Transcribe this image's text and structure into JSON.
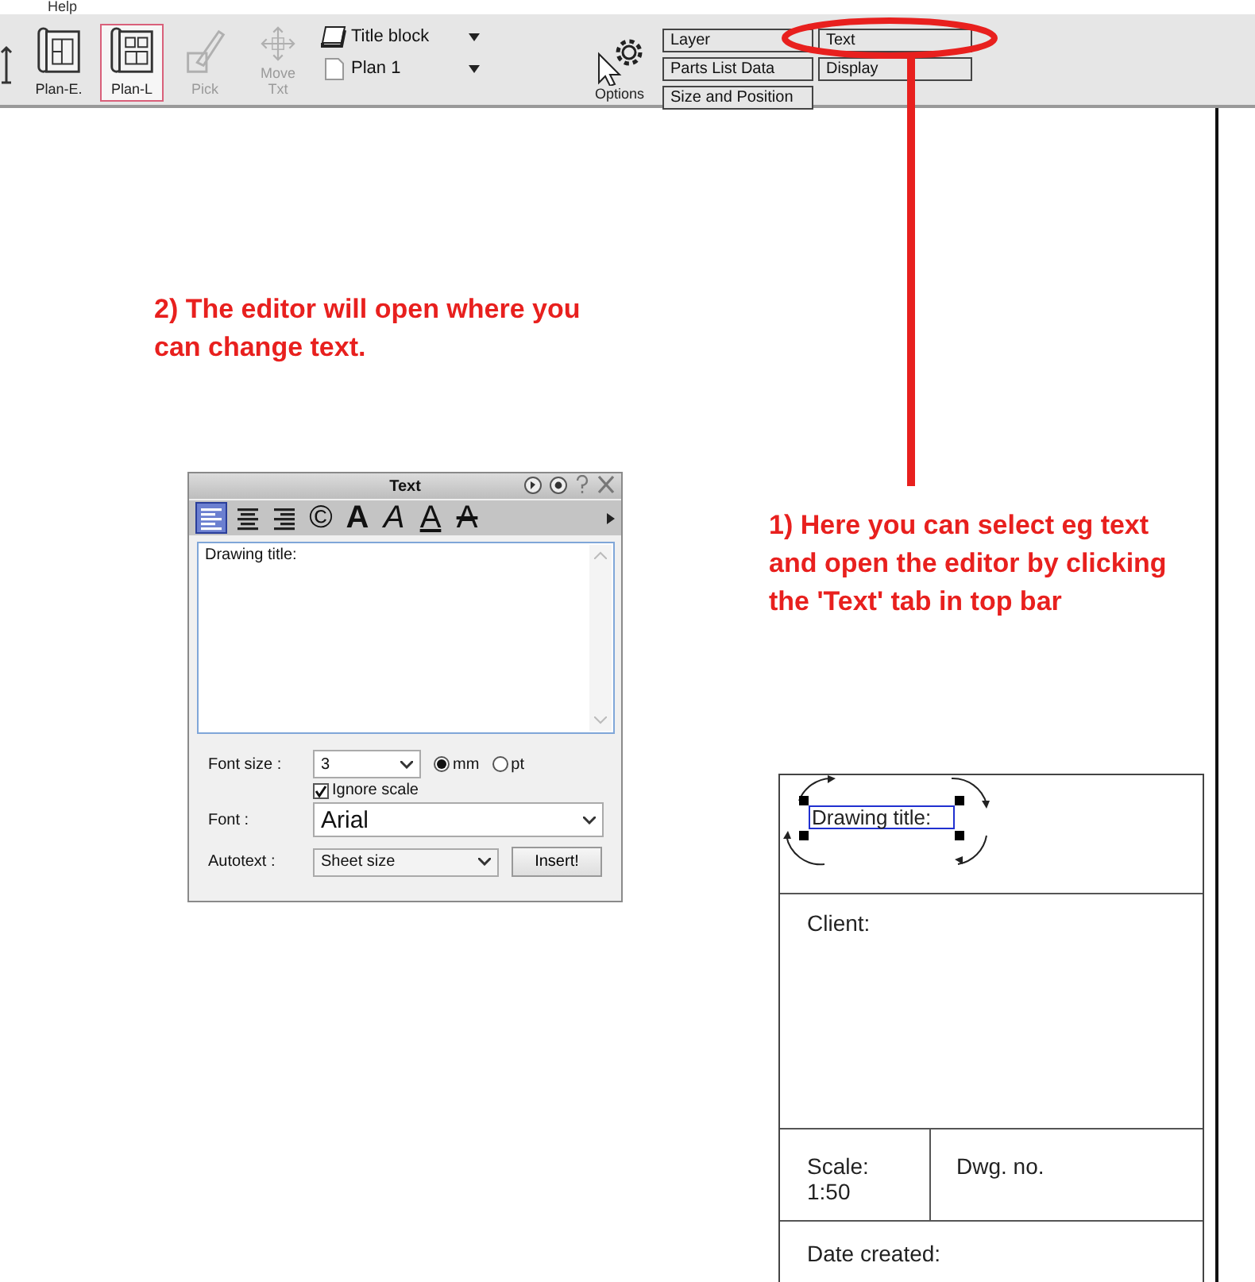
{
  "menu": [
    "Help"
  ],
  "toolbar": {
    "tools": [
      {
        "kind": "plan-e",
        "label": "Plan-E.",
        "selected": false,
        "disabled": false
      },
      {
        "kind": "plan-l",
        "label": "Plan-L",
        "selected": true,
        "disabled": false
      },
      {
        "kind": "pick",
        "label": "Pick",
        "selected": false,
        "disabled": true
      },
      {
        "kind": "move",
        "label": "Move Txt",
        "selected": false,
        "disabled": true
      }
    ],
    "dropdowns": [
      {
        "kind": "layers",
        "label": "Title block"
      },
      {
        "kind": "page",
        "label": "Plan 1"
      }
    ],
    "options": {
      "label": "Options"
    },
    "tabs": [
      {
        "label": "Layer"
      },
      {
        "label": "Text"
      },
      {
        "label": "Parts List Data"
      },
      {
        "label": "Display"
      },
      {
        "label": "Size and Position"
      }
    ]
  },
  "annotations": [
    {
      "text": "2) The editor will open where you can change text."
    },
    {
      "text": "1) Here you can select eg text and open the editor by clicking the 'Text' tab in top bar"
    }
  ],
  "text_dialog": {
    "title": "Text",
    "format_buttons": [
      {
        "kind": "align-left",
        "selected": true
      },
      {
        "kind": "align-center",
        "selected": false
      },
      {
        "kind": "align-right",
        "selected": false
      },
      {
        "kind": "symbol",
        "glyph": "©",
        "selected": false
      },
      {
        "kind": "bold",
        "glyph": "A",
        "selected": false
      },
      {
        "kind": "italic",
        "glyph": "A",
        "selected": false
      },
      {
        "kind": "underline",
        "glyph": "A",
        "selected": false
      },
      {
        "kind": "strike",
        "glyph": "A",
        "selected": false
      }
    ],
    "content": "Drawing title:",
    "font_size": {
      "label": "Font size :",
      "value": "3"
    },
    "units": [
      {
        "label": "mm",
        "selected": true
      },
      {
        "label": "pt",
        "selected": false
      }
    ],
    "ignore_scale": {
      "label": "Ignore scale",
      "checked": true
    },
    "font": {
      "label": "Font :",
      "value": "Arial"
    },
    "autotext": {
      "label": "Autotext :",
      "value": "Sheet size"
    },
    "insert_button": "Insert!"
  },
  "title_block": {
    "title": "Drawing title:",
    "client": "Client:",
    "scale_label": "Scale:",
    "scale_value": "1:50",
    "dwg_no": "Dwg. no.",
    "date_created": "Date created:"
  }
}
